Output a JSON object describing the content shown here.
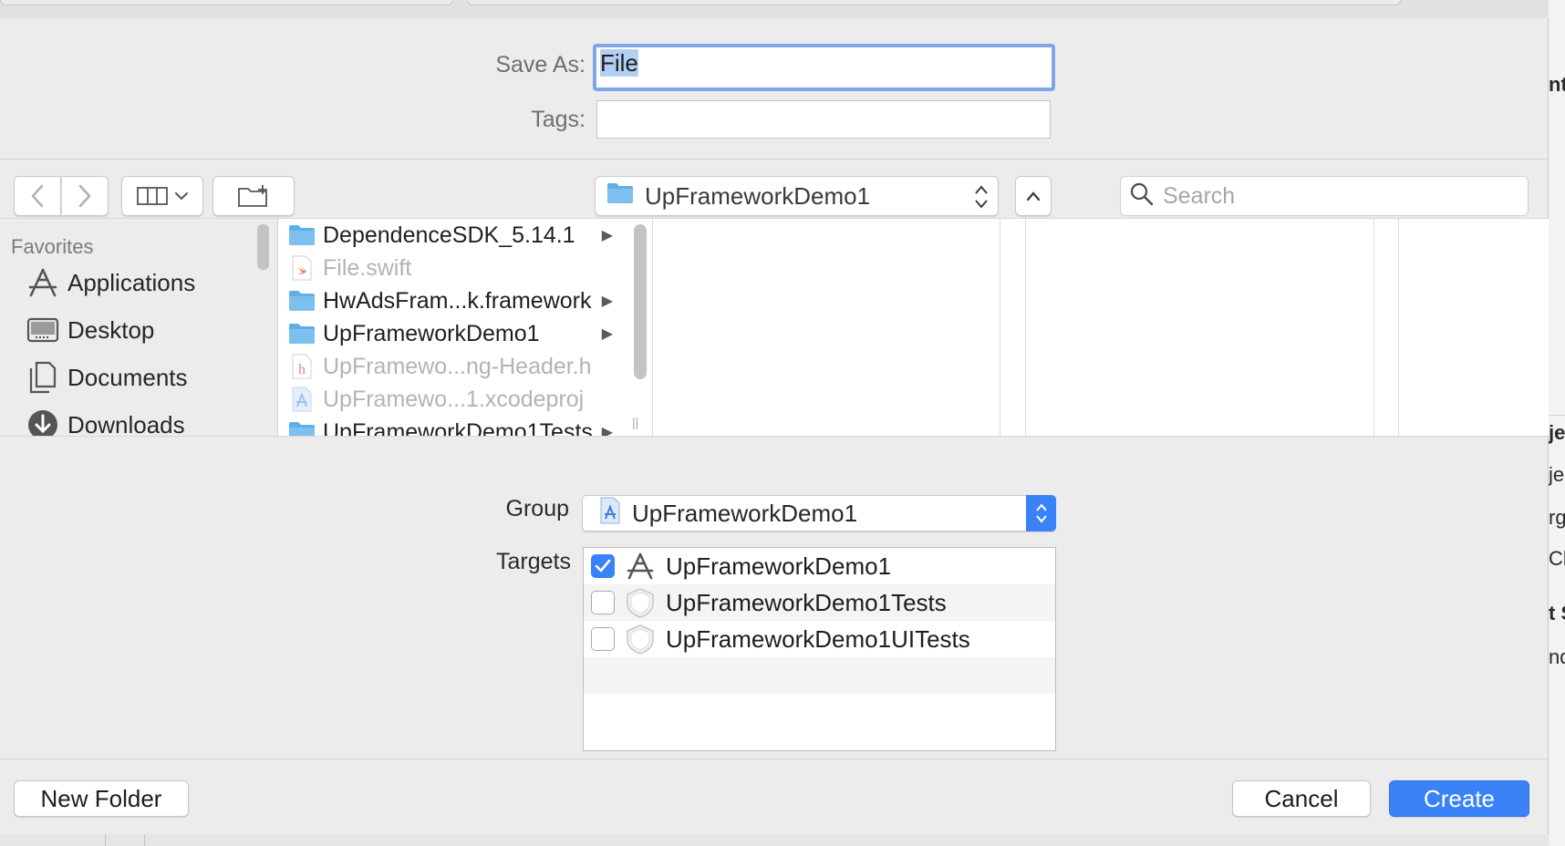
{
  "save_as": {
    "label": "Save As:",
    "value": "File"
  },
  "tags": {
    "label": "Tags:",
    "value": ""
  },
  "toolbar": {
    "back_icon": "chevron-left-icon",
    "forward_icon": "chevron-right-icon",
    "view_icon": "column-view-icon",
    "new_folder_icon": "new-folder-icon",
    "location": "UpFrameworkDemo1",
    "search_placeholder": "Search"
  },
  "sidebar": {
    "section": "Favorites",
    "items": [
      {
        "label": "Applications",
        "icon": "applications-icon"
      },
      {
        "label": "Desktop",
        "icon": "desktop-icon"
      },
      {
        "label": "Documents",
        "icon": "documents-icon"
      },
      {
        "label": "Downloads",
        "icon": "downloads-icon"
      }
    ]
  },
  "files": [
    {
      "name": "DependenceSDK_5.14.1",
      "type": "folder",
      "has_children": true
    },
    {
      "name": "File.swift",
      "type": "swift-file",
      "has_children": false
    },
    {
      "name": "HwAdsFram...k.framework",
      "type": "folder",
      "has_children": true
    },
    {
      "name": "UpFrameworkDemo1",
      "type": "folder",
      "has_children": true
    },
    {
      "name": "UpFramewo...ng-Header.h",
      "type": "header-file",
      "has_children": false
    },
    {
      "name": "UpFramewo...1.xcodeproj",
      "type": "xcodeproj-file",
      "has_children": false
    },
    {
      "name": "UpFrameworkDemo1Tests",
      "type": "folder",
      "has_children": true
    }
  ],
  "group": {
    "label": "Group",
    "value": "UpFrameworkDemo1"
  },
  "targets": {
    "label": "Targets",
    "items": [
      {
        "name": "UpFrameworkDemo1",
        "checked": true,
        "icon": "app-target-icon"
      },
      {
        "name": "UpFrameworkDemo1Tests",
        "checked": false,
        "icon": "test-target-icon"
      },
      {
        "name": "UpFrameworkDemo1UITests",
        "checked": false,
        "icon": "test-target-icon"
      }
    ]
  },
  "buttons": {
    "new_folder": "New Folder",
    "cancel": "Cancel",
    "create": "Create"
  },
  "colors": {
    "accent": "#3a82f7",
    "focus_ring": "#7fa6e8",
    "selection": "#b3d0f4",
    "folder": "#5eaee8"
  },
  "background_fragments": [
    "nti",
    "jec",
    "jec",
    "rg",
    "Cla",
    "t S",
    "nde"
  ]
}
